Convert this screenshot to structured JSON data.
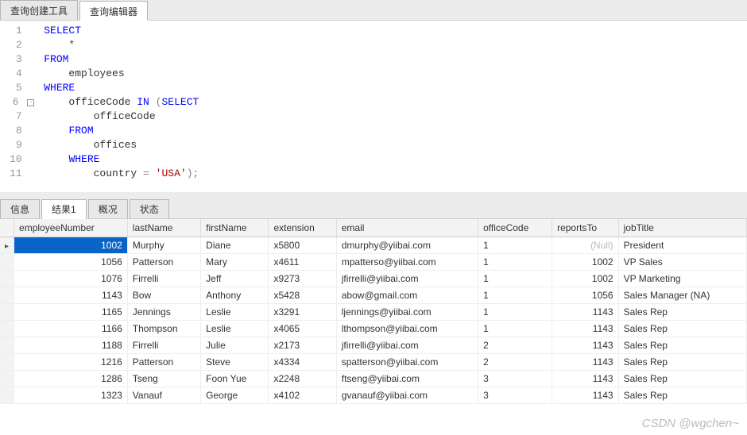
{
  "topTabs": [
    {
      "label": "查询创建工具",
      "active": false
    },
    {
      "label": "查询编辑器",
      "active": true
    }
  ],
  "sql": {
    "lines": [
      {
        "n": 1,
        "fold": "",
        "tokens": [
          [
            "kw",
            "SELECT"
          ]
        ]
      },
      {
        "n": 2,
        "fold": "",
        "tokens": [
          [
            "id",
            "    *"
          ]
        ]
      },
      {
        "n": 3,
        "fold": "",
        "tokens": [
          [
            "kw",
            "FROM"
          ]
        ]
      },
      {
        "n": 4,
        "fold": "",
        "tokens": [
          [
            "id",
            "    employees"
          ]
        ]
      },
      {
        "n": 5,
        "fold": "",
        "tokens": [
          [
            "kw",
            "WHERE"
          ]
        ]
      },
      {
        "n": 6,
        "fold": "-",
        "tokens": [
          [
            "id",
            "    officeCode "
          ],
          [
            "kw",
            "IN"
          ],
          [
            "id",
            " "
          ],
          [
            "op",
            "("
          ],
          [
            "kw",
            "SELECT"
          ]
        ]
      },
      {
        "n": 7,
        "fold": "|",
        "tokens": [
          [
            "id",
            "        officeCode"
          ]
        ]
      },
      {
        "n": 8,
        "fold": "|",
        "tokens": [
          [
            "id",
            "    "
          ],
          [
            "kw",
            "FROM"
          ]
        ]
      },
      {
        "n": 9,
        "fold": "|",
        "tokens": [
          [
            "id",
            "        offices"
          ]
        ]
      },
      {
        "n": 10,
        "fold": "|",
        "tokens": [
          [
            "id",
            "    "
          ],
          [
            "kw",
            "WHERE"
          ]
        ]
      },
      {
        "n": 11,
        "fold": "",
        "tokens": [
          [
            "id",
            "        country "
          ],
          [
            "op",
            "="
          ],
          [
            "id",
            " "
          ],
          [
            "str",
            "'USA'"
          ],
          [
            "op",
            ");"
          ]
        ]
      }
    ]
  },
  "bottomTabs": [
    {
      "label": "信息",
      "active": false
    },
    {
      "label": "结果1",
      "active": true
    },
    {
      "label": "概况",
      "active": false
    },
    {
      "label": "状态",
      "active": false
    }
  ],
  "results": {
    "columns": [
      "employeeNumber",
      "lastName",
      "firstName",
      "extension",
      "email",
      "officeCode",
      "reportsTo",
      "jobTitle"
    ],
    "nullText": "(Null)",
    "rows": [
      {
        "selected": true,
        "cells": [
          "1002",
          "Murphy",
          "Diane",
          "x5800",
          "dmurphy@yiibai.com",
          "1",
          null,
          "President"
        ]
      },
      {
        "selected": false,
        "cells": [
          "1056",
          "Patterson",
          "Mary",
          "x4611",
          "mpatterso@yiibai.com",
          "1",
          "1002",
          "VP Sales"
        ]
      },
      {
        "selected": false,
        "cells": [
          "1076",
          "Firrelli",
          "Jeff",
          "x9273",
          "jfirrelli@yiibai.com",
          "1",
          "1002",
          "VP Marketing"
        ]
      },
      {
        "selected": false,
        "cells": [
          "1143",
          "Bow",
          "Anthony",
          "x5428",
          "abow@gmail.com",
          "1",
          "1056",
          "Sales Manager (NA)"
        ]
      },
      {
        "selected": false,
        "cells": [
          "1165",
          "Jennings",
          "Leslie",
          "x3291",
          "ljennings@yiibai.com",
          "1",
          "1143",
          "Sales Rep"
        ]
      },
      {
        "selected": false,
        "cells": [
          "1166",
          "Thompson",
          "Leslie",
          "x4065",
          "lthompson@yiibai.com",
          "1",
          "1143",
          "Sales Rep"
        ]
      },
      {
        "selected": false,
        "cells": [
          "1188",
          "Firrelli",
          "Julie",
          "x2173",
          "jfirrelli@yiibai.com",
          "2",
          "1143",
          "Sales Rep"
        ]
      },
      {
        "selected": false,
        "cells": [
          "1216",
          "Patterson",
          "Steve",
          "x4334",
          "spatterson@yiibai.com",
          "2",
          "1143",
          "Sales Rep"
        ]
      },
      {
        "selected": false,
        "cells": [
          "1286",
          "Tseng",
          "Foon Yue",
          "x2248",
          "ftseng@yiibai.com",
          "3",
          "1143",
          "Sales Rep"
        ]
      },
      {
        "selected": false,
        "cells": [
          "1323",
          "Vanauf",
          "George",
          "x4102",
          "gvanauf@yiibai.com",
          "3",
          "1143",
          "Sales Rep"
        ]
      }
    ]
  },
  "watermark": "CSDN @wgchen~"
}
